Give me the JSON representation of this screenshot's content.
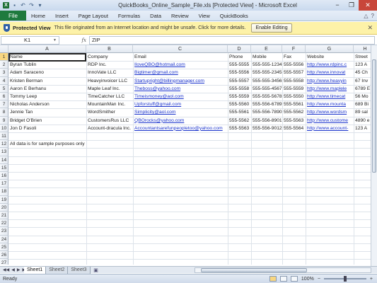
{
  "window": {
    "title": "QuickBooks_Online_Sample_File.xls  [Protected View]  -  Microsoft Excel",
    "minimize": "−",
    "restore": "❐",
    "close": "✕",
    "logo": "X"
  },
  "ribbon": {
    "file": "File",
    "tabs": [
      "Home",
      "Insert",
      "Page Layout",
      "Formulas",
      "Data",
      "Review",
      "View",
      "QuickBooks"
    ],
    "help": "?",
    "minimize_ribbon": "△"
  },
  "protected_view": {
    "title": "Protected View",
    "message": "This file originated from an Internet location and might be unsafe. Click for more details.",
    "enable_button": "Enable Editing",
    "close": "✕"
  },
  "formula_bar": {
    "name_box": "K1",
    "fx": "fx",
    "value": "ZIP"
  },
  "columns": [
    "A",
    "B",
    "C",
    "D",
    "E",
    "F",
    "G",
    "H"
  ],
  "row_numbers": [
    "1",
    "2",
    "3",
    "4",
    "5",
    "6",
    "7",
    "8",
    "9",
    "10",
    "11",
    "12",
    "13",
    "14",
    "15",
    "16",
    "17",
    "18",
    "19",
    "20",
    "21",
    "22",
    "23",
    "24",
    "25",
    "26",
    "27"
  ],
  "rows": [
    [
      "Name",
      "Company",
      "Email",
      "Phone",
      "Mobile",
      "Fax",
      "Website",
      "Street"
    ],
    [
      "Byran Tublin",
      "RDP Inc.",
      "IloveQBO@hotmail.com",
      "555-5555",
      "555-555-1234",
      "555-5556",
      "http://www.rdpinc.c",
      "123 A"
    ],
    [
      "Adam Saraceno",
      "InnoVate LLC",
      "Bigtimer@gmail.com",
      "555-5556",
      "555-555-2345",
      "555-5557",
      "http://www.innovat",
      "45 Ch"
    ],
    [
      "Kristen Berman",
      "Heavyinvoicer LLC",
      "Startupright@billingmanager.com",
      "555-5557",
      "555-555-3456",
      "555-5558",
      "http://www.heavyin",
      "67 Inv"
    ],
    [
      "Aaron E Berhanu",
      "Maple Leaf Inc.",
      "Theboss@yahoo.com",
      "555-5558",
      "555-555-4567",
      "555-5559",
      "http://www.maplele",
      "6789 E"
    ],
    [
      "Tommy Leep",
      "TimeCatcher LLC",
      "Timeismoney@aol.com",
      "555-5559",
      "555-555-5678",
      "555-5550",
      "http://www.timecat",
      "56 Mo"
    ],
    [
      "Nicholas Anderson",
      "MountainMan Inc.",
      "Upforstuff@gmail.com",
      "555-5560",
      "555-556-6789",
      "555-5561",
      "http://www.mounta",
      "689 Bi"
    ],
    [
      "Jennie Tan",
      "WordSmither",
      "Simplicity@aol.com",
      "555-5561",
      "555-556-7890",
      "555-5562",
      "http://www.wordsm",
      "89 sal"
    ],
    [
      "Bridget O'Brien",
      "CustomersRus LLC",
      "QBOrocks@yahoo.com",
      "555-5562",
      "555-556-8901",
      "555-5563",
      "http://www.custome",
      "4890 e"
    ],
    [
      "Jon D Fasoli",
      "Account-dracula Inc.",
      "Accountantsarefunpeopletoo@yahoo.com",
      "555-5563",
      "555-556-9012",
      "555-5564",
      "http://www.account-",
      "123 A"
    ]
  ],
  "note": "All data is for sample purposes only",
  "sheets": [
    "Sheet1",
    "Sheet2",
    "Sheet3"
  ],
  "sheet_nav": [
    "◀◀",
    "◀",
    "▶",
    "▶▶"
  ],
  "status": {
    "ready": "Ready",
    "zoom": "100%",
    "minus": "−",
    "plus": "+"
  },
  "colors": {
    "file_tab": "#1f7a3d",
    "protected_bar": "#fdf2a8",
    "link": "#1a33cc"
  },
  "icons": [
    "excel-logo-icon",
    "save-icon",
    "undo-icon",
    "redo-icon",
    "shield-icon"
  ]
}
